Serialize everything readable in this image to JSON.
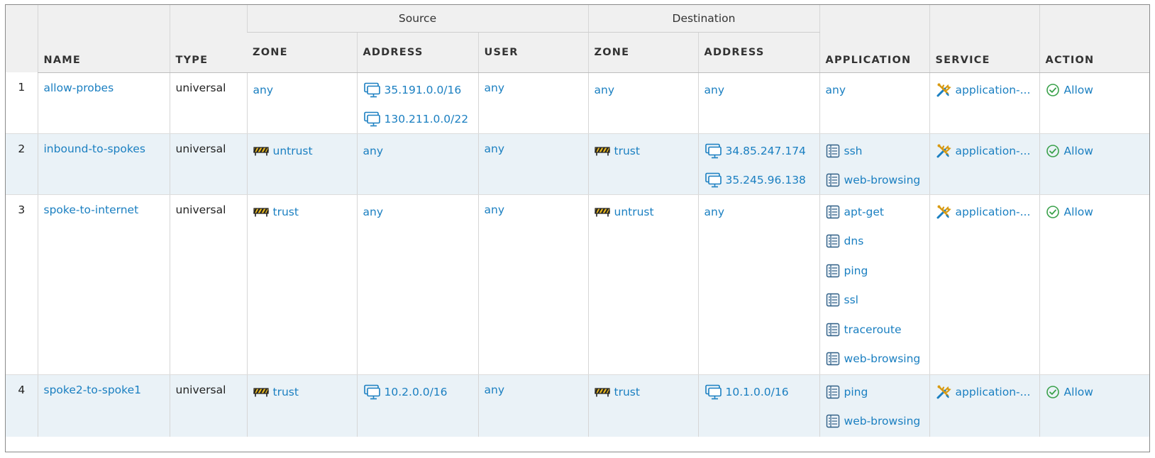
{
  "header": {
    "groups": {
      "source": "Source",
      "destination": "Destination"
    },
    "columns": {
      "name": "NAME",
      "type": "TYPE",
      "source_zone": "ZONE",
      "source_address": "ADDRESS",
      "source_user": "USER",
      "destination_zone": "ZONE",
      "destination_address": "ADDRESS",
      "application": "APPLICATION",
      "service": "SERVICE",
      "action": "ACTION"
    }
  },
  "colors": {
    "link": "#1a7fc1",
    "row_alt": "#eaf2f7",
    "header_bg": "#f0f0f0",
    "allow": "#3aa14b"
  },
  "rules": [
    {
      "num": "1",
      "name": "allow-probes",
      "type": "universal",
      "source_zone": {
        "icon": "zone-icon",
        "items": [
          "any"
        ]
      },
      "source_address": {
        "items": [
          "35.191.0.0/16",
          "130.211.0.0/22"
        ]
      },
      "source_user": "any",
      "destination_zone": {
        "items": [
          "any"
        ]
      },
      "destination_address": {
        "items": [
          "any"
        ]
      },
      "application": {
        "items": [
          "any"
        ]
      },
      "service": "application-...",
      "action": "Allow"
    },
    {
      "num": "2",
      "name": "inbound-to-spokes",
      "type": "universal",
      "source_zone": {
        "items": [
          "untrust"
        ]
      },
      "source_address": {
        "items": [
          "any"
        ]
      },
      "source_user": "any",
      "destination_zone": {
        "items": [
          "trust"
        ]
      },
      "destination_address": {
        "items": [
          "34.85.247.174",
          "35.245.96.138"
        ]
      },
      "application": {
        "items": [
          "ssh",
          "web-browsing"
        ]
      },
      "service": "application-...",
      "action": "Allow"
    },
    {
      "num": "3",
      "name": "spoke-to-internet",
      "type": "universal",
      "source_zone": {
        "items": [
          "trust"
        ]
      },
      "source_address": {
        "items": [
          "any"
        ]
      },
      "source_user": "any",
      "destination_zone": {
        "items": [
          "untrust"
        ]
      },
      "destination_address": {
        "items": [
          "any"
        ]
      },
      "application": {
        "items": [
          "apt-get",
          "dns",
          "ping",
          "ssl",
          "traceroute",
          "web-browsing"
        ]
      },
      "service": "application-...",
      "action": "Allow"
    },
    {
      "num": "4",
      "name": "spoke2-to-spoke1",
      "type": "universal",
      "source_zone": {
        "items": [
          "trust"
        ]
      },
      "source_address": {
        "items": [
          "10.2.0.0/16"
        ]
      },
      "source_user": "any",
      "destination_zone": {
        "items": [
          "trust"
        ]
      },
      "destination_address": {
        "items": [
          "10.1.0.0/16"
        ]
      },
      "application": {
        "items": [
          "ping",
          "web-browsing"
        ]
      },
      "service": "application-...",
      "action": "Allow"
    }
  ]
}
